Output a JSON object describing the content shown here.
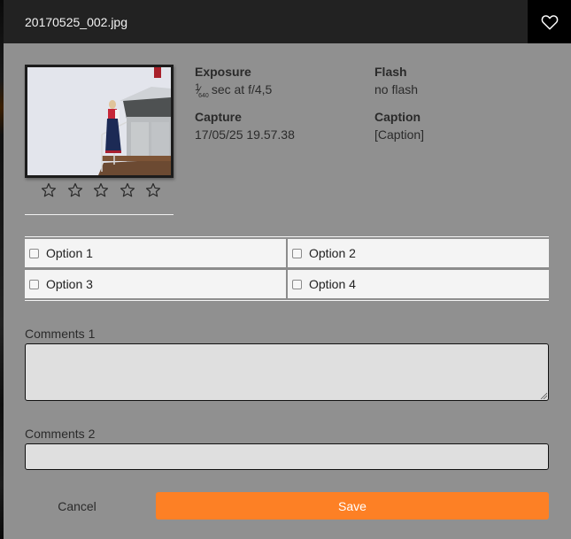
{
  "header": {
    "title": "20170525_002.jpg",
    "favorite_icon": "heart-outline-icon"
  },
  "image": {
    "rating": 0,
    "rating_max": 5,
    "star_icon": "star-outline-icon"
  },
  "metadata": {
    "exposure": {
      "label": "Exposure",
      "shutter_numerator": "1",
      "shutter_denominator": "640",
      "value_suffix": "sec at f/4,5"
    },
    "flash": {
      "label": "Flash",
      "value": "no flash"
    },
    "capture": {
      "label": "Capture",
      "value": "17/05/25 19.57.38"
    },
    "caption": {
      "label": "Caption",
      "value": "[Caption]"
    }
  },
  "options": [
    {
      "label": "Option 1",
      "checked": false
    },
    {
      "label": "Option 2",
      "checked": false
    },
    {
      "label": "Option 3",
      "checked": false
    },
    {
      "label": "Option 4",
      "checked": false
    }
  ],
  "comments1": {
    "label": "Comments 1",
    "value": "",
    "placeholder": ""
  },
  "comments2": {
    "label": "Comments 2",
    "value": "",
    "placeholder": ""
  },
  "actions": {
    "cancel_label": "Cancel",
    "save_label": "Save"
  },
  "colors": {
    "accent": "#fd8025",
    "header_bg": "#222222",
    "dialog_bg": "#909090"
  }
}
